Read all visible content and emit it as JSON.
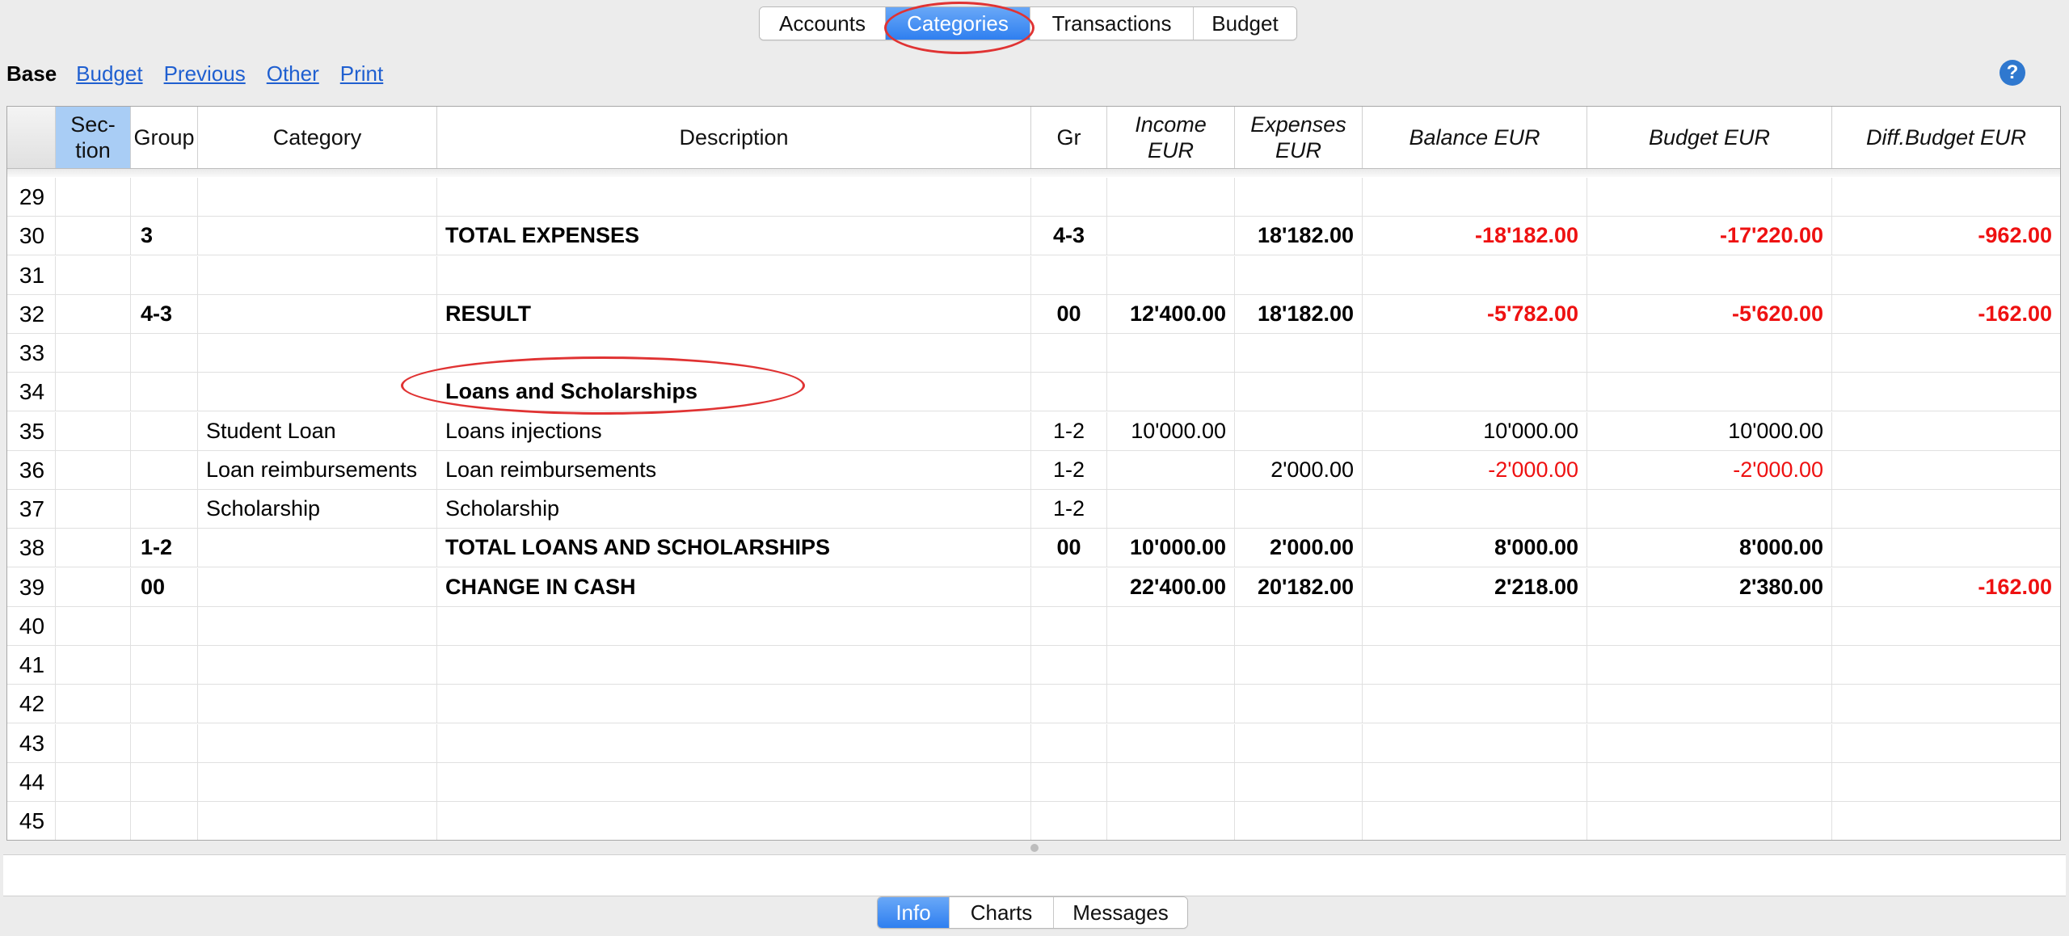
{
  "top_tabs": [
    {
      "label": "Accounts",
      "active": false
    },
    {
      "label": "Categories",
      "active": true
    },
    {
      "label": "Transactions",
      "active": false
    },
    {
      "label": "Budget",
      "active": false
    }
  ],
  "view_bar": {
    "current": "Base",
    "links": [
      "Budget",
      "Previous",
      "Other",
      "Print"
    ],
    "help_icon": "?"
  },
  "columns": [
    {
      "label": "",
      "italic": false
    },
    {
      "label": "Sec-\ntion",
      "italic": false,
      "selected": true
    },
    {
      "label": "Group",
      "italic": false
    },
    {
      "label": "Category",
      "italic": false
    },
    {
      "label": "Description",
      "italic": false
    },
    {
      "label": "Gr",
      "italic": false
    },
    {
      "label": "Income\nEUR",
      "italic": true
    },
    {
      "label": "Expenses\nEUR",
      "italic": true
    },
    {
      "label": "Balance EUR",
      "italic": true
    },
    {
      "label": "Budget EUR",
      "italic": true
    },
    {
      "label": "Diff.Budget EUR",
      "italic": true
    }
  ],
  "rows": [
    {
      "n": "29",
      "section": "",
      "group": "",
      "category": "",
      "description": "",
      "gr": "",
      "income": "",
      "expenses": "",
      "balance": "",
      "budget": "",
      "diff": "",
      "bold": false
    },
    {
      "n": "30",
      "section": "",
      "group": "3",
      "category": "",
      "description": "TOTAL EXPENSES",
      "gr": "4-3",
      "income": "",
      "expenses": "18'182.00",
      "balance": "-18'182.00",
      "budget": "-17'220.00",
      "diff": "-962.00",
      "bold": true
    },
    {
      "n": "31",
      "section": "",
      "group": "",
      "category": "",
      "description": "",
      "gr": "",
      "income": "",
      "expenses": "",
      "balance": "",
      "budget": "",
      "diff": "",
      "bold": false
    },
    {
      "n": "32",
      "section": "",
      "group": "4-3",
      "category": "",
      "description": "RESULT",
      "gr": "00",
      "income": "12'400.00",
      "expenses": "18'182.00",
      "balance": "-5'782.00",
      "budget": "-5'620.00",
      "diff": "-162.00",
      "bold": true
    },
    {
      "n": "33",
      "section": "",
      "group": "",
      "category": "",
      "description": "",
      "gr": "",
      "income": "",
      "expenses": "",
      "balance": "",
      "budget": "",
      "diff": "",
      "bold": false
    },
    {
      "n": "34",
      "section": "",
      "group": "",
      "category": "",
      "description": "Loans and Scholarships",
      "gr": "",
      "income": "",
      "expenses": "",
      "balance": "",
      "budget": "",
      "diff": "",
      "bold": true
    },
    {
      "n": "35",
      "section": "",
      "group": "",
      "category": "Student Loan",
      "description": "Loans injections",
      "gr": "1-2",
      "income": "10'000.00",
      "expenses": "",
      "balance": "10'000.00",
      "budget": "10'000.00",
      "diff": "",
      "bold": false
    },
    {
      "n": "36",
      "section": "",
      "group": "",
      "category": "Loan reimbursements",
      "description": "Loan reimbursements",
      "gr": "1-2",
      "income": "",
      "expenses": "2'000.00",
      "balance": "-2'000.00",
      "budget": "-2'000.00",
      "diff": "",
      "bold": false
    },
    {
      "n": "37",
      "section": "",
      "group": "",
      "category": "Scholarship",
      "description": "Scholarship",
      "gr": "1-2",
      "income": "",
      "expenses": "",
      "balance": "",
      "budget": "",
      "diff": "",
      "bold": false
    },
    {
      "n": "38",
      "section": "",
      "group": "1-2",
      "category": "",
      "description": "TOTAL LOANS AND SCHOLARSHIPS",
      "gr": "00",
      "income": "10'000.00",
      "expenses": "2'000.00",
      "balance": "8'000.00",
      "budget": "8'000.00",
      "diff": "",
      "bold": true
    },
    {
      "n": "39",
      "section": "",
      "group": "00",
      "category": "",
      "description": "CHANGE IN CASH",
      "gr": "",
      "income": "22'400.00",
      "expenses": "20'182.00",
      "balance": "2'218.00",
      "budget": "2'380.00",
      "diff": "-162.00",
      "bold": true
    },
    {
      "n": "40",
      "section": "",
      "group": "",
      "category": "",
      "description": "",
      "gr": "",
      "income": "",
      "expenses": "",
      "balance": "",
      "budget": "",
      "diff": "",
      "bold": false
    },
    {
      "n": "41",
      "section": "",
      "group": "",
      "category": "",
      "description": "",
      "gr": "",
      "income": "",
      "expenses": "",
      "balance": "",
      "budget": "",
      "diff": "",
      "bold": false
    },
    {
      "n": "42",
      "section": "",
      "group": "",
      "category": "",
      "description": "",
      "gr": "",
      "income": "",
      "expenses": "",
      "balance": "",
      "budget": "",
      "diff": "",
      "bold": false
    },
    {
      "n": "43",
      "section": "",
      "group": "",
      "category": "",
      "description": "",
      "gr": "",
      "income": "",
      "expenses": "",
      "balance": "",
      "budget": "",
      "diff": "",
      "bold": false
    },
    {
      "n": "44",
      "section": "",
      "group": "",
      "category": "",
      "description": "",
      "gr": "",
      "income": "",
      "expenses": "",
      "balance": "",
      "budget": "",
      "diff": "",
      "bold": false
    },
    {
      "n": "45",
      "section": "",
      "group": "",
      "category": "",
      "description": "",
      "gr": "",
      "income": "",
      "expenses": "",
      "balance": "",
      "budget": "",
      "diff": "",
      "bold": false
    }
  ],
  "bottom_tabs": [
    {
      "label": "Info",
      "active": true
    },
    {
      "label": "Charts",
      "active": false
    },
    {
      "label": "Messages",
      "active": false
    }
  ],
  "colors": {
    "accent": "#2f7ff0",
    "negative": "#ee1111",
    "highlight_ring": "#e03333",
    "selected_column": "#a9cdf5",
    "link": "#1f5fd0"
  }
}
